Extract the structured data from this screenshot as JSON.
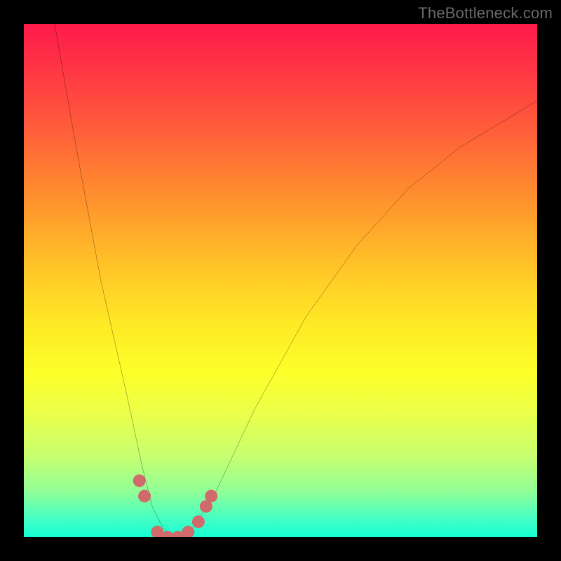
{
  "watermark": "TheBottleneck.com",
  "chart_data": {
    "type": "line",
    "title": "",
    "xlabel": "",
    "ylabel": "",
    "xlim": [
      0,
      100
    ],
    "ylim": [
      0,
      100
    ],
    "grid": false,
    "legend": false,
    "background_gradient": {
      "top_color": "#ff1a4b",
      "mid_color": "#ffe825",
      "bottom_color": "#15ffd6",
      "meaning": "red (high bottleneck) to green (no bottleneck)"
    },
    "series": [
      {
        "name": "bottleneck-curve",
        "color": "#000000",
        "x": [
          6,
          10,
          15,
          20,
          23,
          25,
          27,
          29,
          31,
          33,
          37,
          45,
          55,
          65,
          75,
          85,
          95,
          100
        ],
        "y": [
          100,
          77,
          50,
          28,
          14,
          6,
          2,
          0,
          0,
          2,
          8,
          25,
          43,
          57,
          68,
          76,
          82,
          85
        ]
      }
    ],
    "markers": [
      {
        "name": "highlight-dots",
        "color": "#d16a6a",
        "radius": 9,
        "points": [
          {
            "x": 22.5,
            "y": 11
          },
          {
            "x": 23.5,
            "y": 8
          },
          {
            "x": 26.0,
            "y": 1
          },
          {
            "x": 28.0,
            "y": 0
          },
          {
            "x": 30.0,
            "y": 0
          },
          {
            "x": 32.0,
            "y": 1
          },
          {
            "x": 34.0,
            "y": 3
          },
          {
            "x": 35.5,
            "y": 6
          },
          {
            "x": 36.5,
            "y": 8
          }
        ]
      }
    ],
    "minimum_at_x": 29,
    "minimum_value": 0
  }
}
